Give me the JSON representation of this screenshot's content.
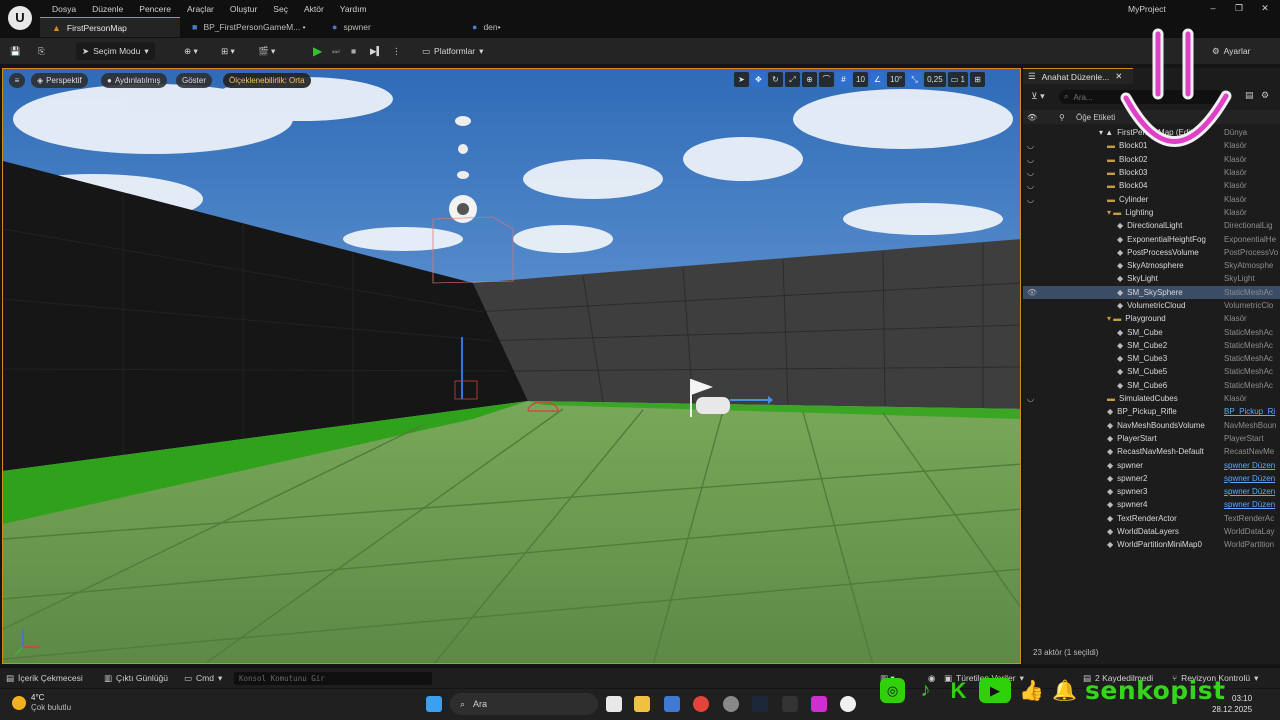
{
  "app": {
    "logo_glyph": "U",
    "menu": [
      "Dosya",
      "Düzenle",
      "Pencere",
      "Araçlar",
      "Oluştur",
      "Seç",
      "Aktör",
      "Yardım"
    ],
    "project_name": "MyProject",
    "window_controls": [
      "–",
      "❐",
      "✕"
    ],
    "tabs": [
      {
        "label": "FirstPersonMap",
        "icon": "map-icon",
        "active": true
      },
      {
        "label": "BP_FirstPersonGameM... •",
        "icon": "blueprint-icon",
        "active": false
      },
      {
        "label": "spwner",
        "icon": "blueprint-icon",
        "active": false
      },
      {
        "label": "den•",
        "icon": "blueprint-icon",
        "active": false
      }
    ]
  },
  "toolbar": {
    "mode_label": "Seçim Modu",
    "platforms_label": "Platformlar",
    "settings_label": "Ayarlar"
  },
  "viewport": {
    "perspective_label": "Perspektif",
    "lit_label": "Aydınlatılmış",
    "show_label": "Göster",
    "scalability_label": "Ölçeklenebilirlik: Orta",
    "grid_snap": "10",
    "rotation_snap": "10°",
    "scale_snap": "0,25",
    "camera_speed": "1"
  },
  "outliner": {
    "tab_label": "Anahat Düzenle...",
    "search_placeholder": "Ara...",
    "col_label": "Öğe Etiketi",
    "rows": [
      {
        "name": "FirstPersonMap (Editör)",
        "type": "Dünya",
        "indent": 0,
        "kind": "world",
        "eye": false
      },
      {
        "name": "Block01",
        "type": "Klasör",
        "indent": 1,
        "kind": "folder",
        "eye": true
      },
      {
        "name": "Block02",
        "type": "Klasör",
        "indent": 1,
        "kind": "folder",
        "eye": true
      },
      {
        "name": "Block03",
        "type": "Klasör",
        "indent": 1,
        "kind": "folder",
        "eye": true
      },
      {
        "name": "Block04",
        "type": "Klasör",
        "indent": 1,
        "kind": "folder",
        "eye": true
      },
      {
        "name": "Cylinder",
        "type": "Klasör",
        "indent": 1,
        "kind": "folder",
        "eye": true
      },
      {
        "name": "Lighting",
        "type": "Klasör",
        "indent": 1,
        "kind": "folder-open",
        "eye": false
      },
      {
        "name": "DirectionalLight",
        "type": "DirectionalLig",
        "indent": 2,
        "kind": "actor",
        "eye": false
      },
      {
        "name": "ExponentialHeightFog",
        "type": "ExponentialHe",
        "indent": 2,
        "kind": "actor",
        "eye": false
      },
      {
        "name": "PostProcessVolume",
        "type": "PostProcessVo",
        "indent": 2,
        "kind": "actor",
        "eye": false
      },
      {
        "name": "SkyAtmosphere",
        "type": "SkyAtmosphe",
        "indent": 2,
        "kind": "actor",
        "eye": false
      },
      {
        "name": "SkyLight",
        "type": "SkyLight",
        "indent": 2,
        "kind": "actor",
        "eye": false
      },
      {
        "name": "SM_SkySphere",
        "type": "StaticMeshAc",
        "indent": 2,
        "kind": "actor",
        "eye": true,
        "selected": true
      },
      {
        "name": "VolumetricCloud",
        "type": "VolumetricClo",
        "indent": 2,
        "kind": "actor",
        "eye": false
      },
      {
        "name": "Playground",
        "type": "Klasör",
        "indent": 1,
        "kind": "folder-open",
        "eye": false
      },
      {
        "name": "SM_Cube",
        "type": "StaticMeshAc",
        "indent": 2,
        "kind": "actor",
        "eye": false
      },
      {
        "name": "SM_Cube2",
        "type": "StaticMeshAc",
        "indent": 2,
        "kind": "actor",
        "eye": false
      },
      {
        "name": "SM_Cube3",
        "type": "StaticMeshAc",
        "indent": 2,
        "kind": "actor",
        "eye": false
      },
      {
        "name": "SM_Cube5",
        "type": "StaticMeshAc",
        "indent": 2,
        "kind": "actor",
        "eye": false
      },
      {
        "name": "SM_Cube6",
        "type": "StaticMeshAc",
        "indent": 2,
        "kind": "actor",
        "eye": false
      },
      {
        "name": "SimulatedCubes",
        "type": "Klasör",
        "indent": 1,
        "kind": "folder",
        "eye": true
      },
      {
        "name": "BP_Pickup_Rifle",
        "type": "BP_Pickup_Ri",
        "indent": 1,
        "kind": "actor",
        "eye": false,
        "link": true
      },
      {
        "name": "NavMeshBoundsVolume",
        "type": "NavMeshBoun",
        "indent": 1,
        "kind": "actor",
        "eye": false
      },
      {
        "name": "PlayerStart",
        "type": "PlayerStart",
        "indent": 1,
        "kind": "actor",
        "eye": false
      },
      {
        "name": "RecastNavMesh-Default",
        "type": "RecastNavMe",
        "indent": 1,
        "kind": "actor",
        "eye": false
      },
      {
        "name": "spwner",
        "type": "spwner Düzen",
        "indent": 1,
        "kind": "actor",
        "eye": false,
        "link": true
      },
      {
        "name": "spwner2",
        "type": "spwner Düzen",
        "indent": 1,
        "kind": "actor",
        "eye": false,
        "link": true
      },
      {
        "name": "spwner3",
        "type": "spwner Düzen",
        "indent": 1,
        "kind": "actor",
        "eye": false,
        "link": true
      },
      {
        "name": "spwner4",
        "type": "spwner Düzen",
        "indent": 1,
        "kind": "actor",
        "eye": false,
        "link": true
      },
      {
        "name": "TextRenderActor",
        "type": "TextRenderAc",
        "indent": 1,
        "kind": "actor",
        "eye": false
      },
      {
        "name": "WorldDataLayers",
        "type": "WorldDataLay",
        "indent": 1,
        "kind": "actor",
        "eye": false
      },
      {
        "name": "WorldPartitionMiniMap0",
        "type": "WorldPartition",
        "indent": 1,
        "kind": "actor",
        "eye": false
      }
    ],
    "count_label": "23 aktör (1 seçildi)"
  },
  "statusbar": {
    "content_drawer": "İçerik Çekmecesi",
    "output_log": "Çıktı Günlüğü",
    "cmd": "Cmd",
    "console_placeholder": "Konsol Komutunu Gir",
    "derived_data": "Türetilen Veriler",
    "unsaved": "2 Kaydedilmedi",
    "revision": "Revizyon Kontrolü"
  },
  "taskbar": {
    "temperature": "4°C",
    "weather": "Çok bulutlu",
    "search_label": "Ara",
    "time": "03:10",
    "date": "28.12.2025"
  },
  "watermark": {
    "brand": "senkopist",
    "accent": "#2fd10b",
    "smiley_color": "#e040c8"
  },
  "colors": {
    "accent": "#d38b1c",
    "selection": "#3b4c66",
    "play": "#35c12c",
    "link": "#5fa8ff"
  }
}
